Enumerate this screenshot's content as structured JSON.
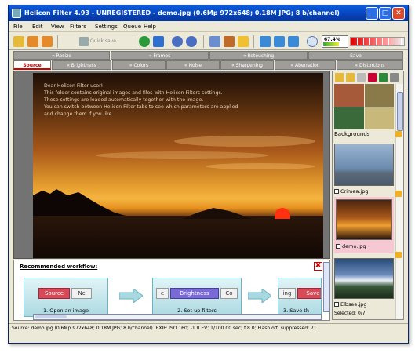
{
  "window": {
    "title": "Helicon Filter 4.93 - UNREGISTERED - demo.jpg (0.6Mp 972x648; 0.18M JPG; 8 b/channel)"
  },
  "menu": [
    "File",
    "Edit",
    "View",
    "Filters",
    "Settings",
    "Queue",
    "Help"
  ],
  "toolbar": {
    "quick_save": "Quick save",
    "zoom_percent": "67.4%",
    "zoom_fraction": 0.674
  },
  "tabs_row1": [
    "« Resize",
    "« Frames",
    "« Retouching",
    "Save"
  ],
  "tabs_row2": [
    "Source",
    "« Brightness",
    "« Colors",
    "« Noise",
    "« Sharpening",
    "« Aberration",
    "« Distortions"
  ],
  "active_tab": "Source",
  "overlay_text": [
    "Dear Helicon Filter user!",
    "This folder contains original images and files with Helicon Filters settings.",
    "These settings are loaded automatically together with the image.",
    "You can switch between Helicon Filter tabs to see which parameters are applied",
    "and change them if you like."
  ],
  "browser": {
    "backgrounds_label": "Backgrounds",
    "items": [
      "Crimea.jpg",
      "demo.jpg",
      "Elbsee.jpg"
    ],
    "selected": "Selected: 0/7"
  },
  "workflow": {
    "title": "Recommended workflow:",
    "close": "✖",
    "steps": [
      "1. Open an image",
      "2. Set up filters",
      "3. Save th"
    ],
    "step1_btn": "Source",
    "step1_btn2": "Nc",
    "step2_btn": "Brightness",
    "step2_left": "e",
    "step2_right": "Co",
    "step3_left": "ing",
    "step3_btn": "Save"
  },
  "status": "Source: demo.jpg (0.6Mp 972x648; 0.18M JPG; 8 b/channel).  EXIF: ISO 160; -1.0 EV; 1/100.00 sec; f 8.0; Flash off, suppressed; 71",
  "colors": {
    "titlebar": "#0842b8",
    "tab_active": "#d40000",
    "tab_inactive": "#9e9d99"
  }
}
